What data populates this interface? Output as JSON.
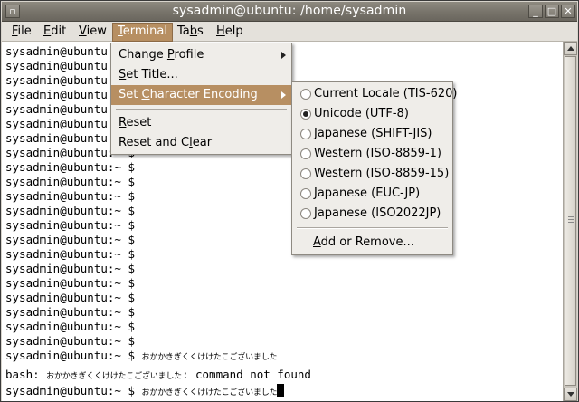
{
  "window": {
    "title": "sysadmin@ubuntu: /home/sysadmin"
  },
  "titlebar_icons": [
    "terminal-menu-icon",
    "minimize-icon",
    "maximize-icon",
    "close-icon"
  ],
  "menubar": {
    "items": [
      {
        "label": "File",
        "u": "F",
        "rest": "ile"
      },
      {
        "label": "Edit",
        "u": "E",
        "rest": "dit"
      },
      {
        "label": "View",
        "u": "V",
        "rest": "iew"
      },
      {
        "label": "Terminal",
        "u": "T",
        "rest": "erminal"
      },
      {
        "label": "Tabs",
        "pre": "Ta",
        "u": "b",
        "rest": "s"
      },
      {
        "label": "Help",
        "u": "H",
        "rest": "elp"
      }
    ],
    "active": "Terminal"
  },
  "terminal_menu": {
    "items": [
      {
        "pre": "Change ",
        "u": "P",
        "rest": "rofile"
      },
      {
        "pre": "",
        "u": "S",
        "rest": "et Title..."
      },
      {
        "pre": "Set ",
        "u": "C",
        "rest": "haracter Encoding"
      },
      {
        "pre": "",
        "u": "R",
        "rest": "eset"
      },
      {
        "pre": "Reset and C",
        "u": "l",
        "rest": "ear"
      }
    ],
    "highlighted": "Set Character Encoding"
  },
  "encoding_menu": {
    "items": [
      {
        "label": "Current Locale (TIS-620)",
        "selected": false
      },
      {
        "label": "Unicode (UTF-8)",
        "selected": true
      },
      {
        "label": "Japanese (SHIFT-JIS)",
        "selected": false
      },
      {
        "label": "Western (ISO-8859-1)",
        "selected": false
      },
      {
        "label": "Western (ISO-8859-15)",
        "selected": false
      },
      {
        "label": "Japanese (EUC-JP)",
        "selected": false
      },
      {
        "label": "Japanese (ISO2022JP)",
        "selected": false
      }
    ],
    "add_remove": {
      "pre": "",
      "u": "A",
      "rest": "dd or Remove..."
    }
  },
  "terminal": {
    "partial_prompt": "sysadmin@ubuntu",
    "prompt": "sysadmin@ubuntu:~ $",
    "japanese_text": "おかかきぎくくけけたこございました",
    "bash_prefix": "bash: ",
    "bash_suffix": ": command not found"
  }
}
